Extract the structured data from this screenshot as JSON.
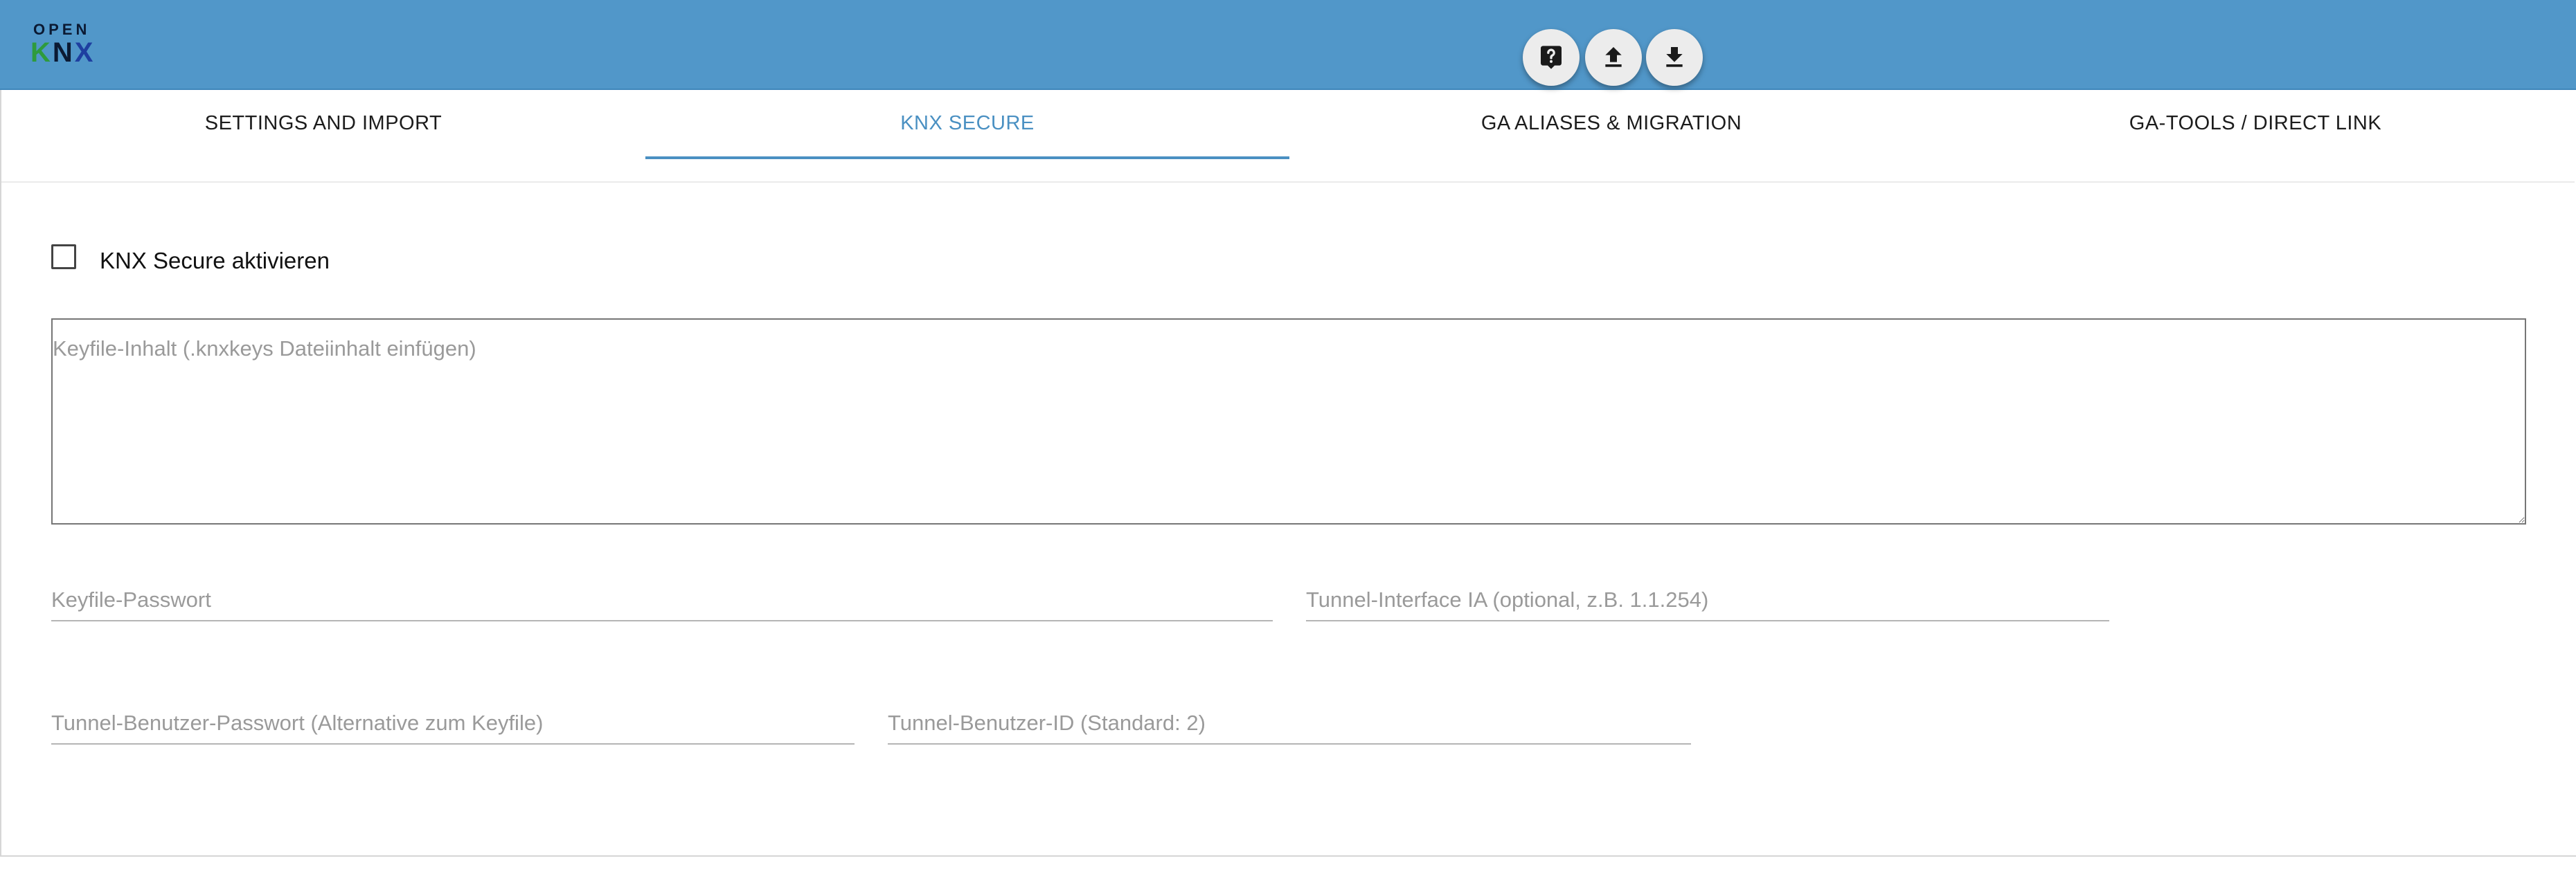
{
  "logo": {
    "top": "OPEN",
    "k": "K",
    "n": "N",
    "x": "X"
  },
  "toolbar": {
    "help_icon": "help-icon",
    "upload_icon": "upload-icon",
    "download_icon": "download-icon"
  },
  "tabs": [
    {
      "label": "SETTINGS AND IMPORT",
      "active": false
    },
    {
      "label": "KNX SECURE",
      "active": true
    },
    {
      "label": "GA ALIASES & MIGRATION",
      "active": false
    },
    {
      "label": "GA-TOOLS / DIRECT LINK",
      "active": false
    }
  ],
  "secure": {
    "enable_label": "KNX Secure aktivieren",
    "enabled": false,
    "keyfile_placeholder": "Keyfile-Inhalt (.knxkeys Dateiinhalt einfügen)",
    "keyfile_password_placeholder": "Keyfile-Passwort",
    "tunnel_ia_placeholder": "Tunnel-Interface IA (optional, z.B. 1.1.254)",
    "tunnel_user_password_placeholder": "Tunnel-Benutzer-Passwort (Alternative zum Keyfile)",
    "tunnel_user_id_placeholder": "Tunnel-Benutzer-ID (Standard: 2)"
  },
  "colors": {
    "header": "#5197c9",
    "accent": "#4a90c2"
  }
}
